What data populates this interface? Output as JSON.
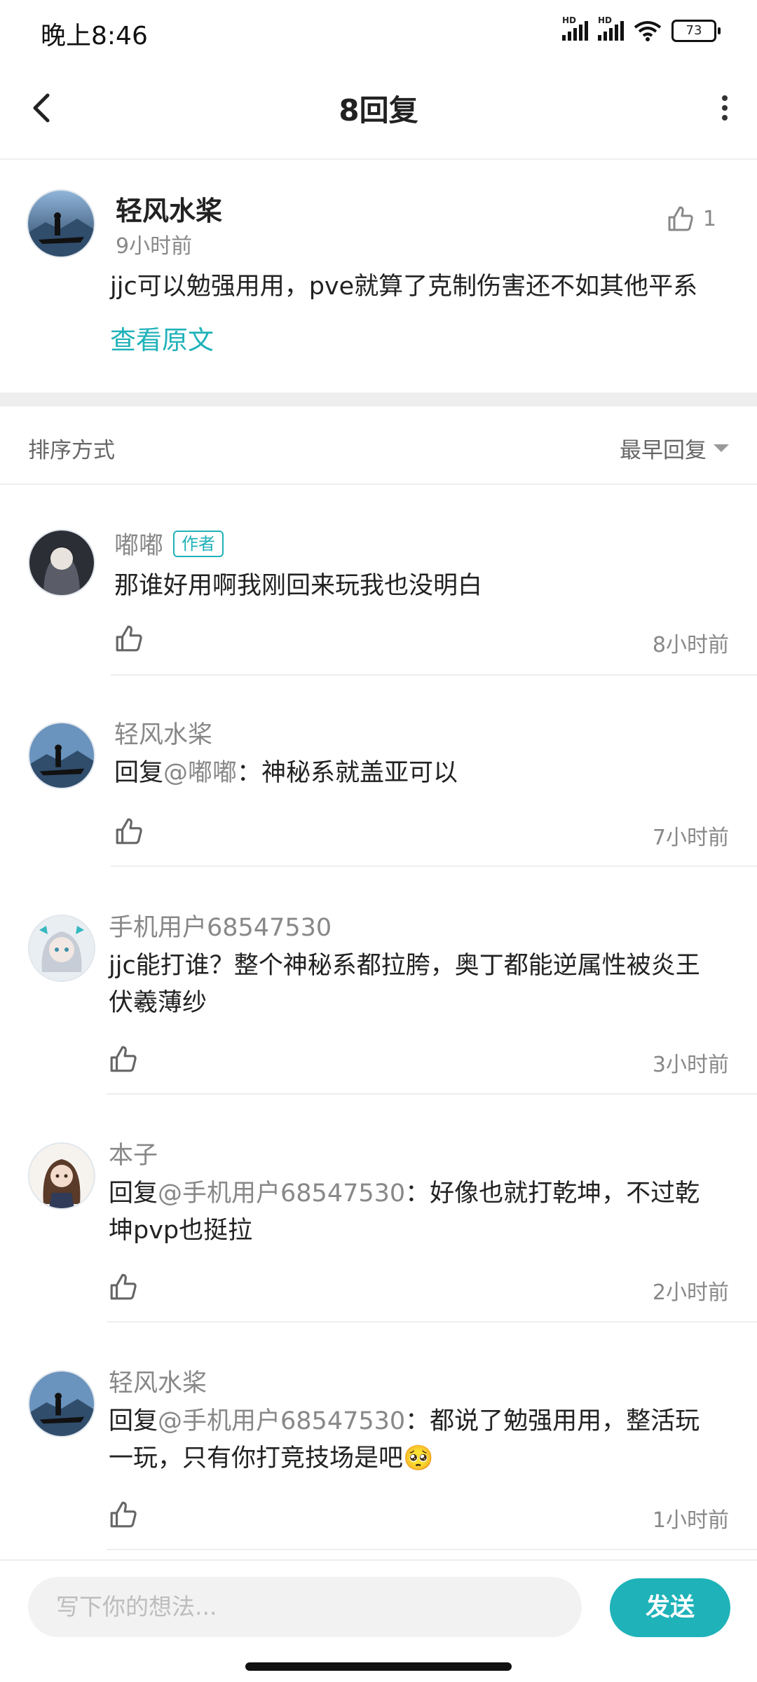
{
  "status_bar": {
    "time": "晚上8:46",
    "battery": "73",
    "signal1": "HD",
    "signal2": "HD"
  },
  "header": {
    "title": "8回复"
  },
  "main_comment": {
    "author": "轻风水桨",
    "time": "9小时前",
    "likes": "1",
    "content": "jjc可以勉强用用，pve就算了克制伤害还不如其他平系",
    "view_original": "查看原文"
  },
  "sort": {
    "label": "排序方式",
    "selected": "最早回复"
  },
  "replies": [
    {
      "author": "嘟嘟",
      "badge": "作者",
      "mention": "",
      "prefix": "",
      "text": "那谁好用啊我刚回来玩我也没明白",
      "time": "8小时前"
    },
    {
      "author": "轻风水桨",
      "badge": "",
      "prefix": "回复",
      "mention": "@嘟嘟",
      "text": "：神秘系就盖亚可以",
      "time": "7小时前"
    },
    {
      "author": "手机用户68547530",
      "badge": "",
      "prefix": "",
      "mention": "",
      "text": "jjc能打谁？整个神秘系都拉胯，奥丁都能逆属性被炎王伏羲薄纱",
      "time": "3小时前"
    },
    {
      "author": "本子",
      "badge": "",
      "prefix": "回复",
      "mention": "@手机用户68547530",
      "text": "：好像也就打乾坤，不过乾坤pvp也挺拉",
      "time": "2小时前"
    },
    {
      "author": "轻风水桨",
      "badge": "",
      "prefix": "回复",
      "mention": "@手机用户68547530",
      "text": "：都说了勉强用用，整活玩一玩，只有你打竞技场是吧🥺",
      "time": "1小时前"
    }
  ],
  "composer": {
    "placeholder": "写下你的想法...",
    "send_label": "发送"
  },
  "colors": {
    "accent": "#1fb2b9",
    "muted": "#888888",
    "divider": "#eeeeee"
  }
}
